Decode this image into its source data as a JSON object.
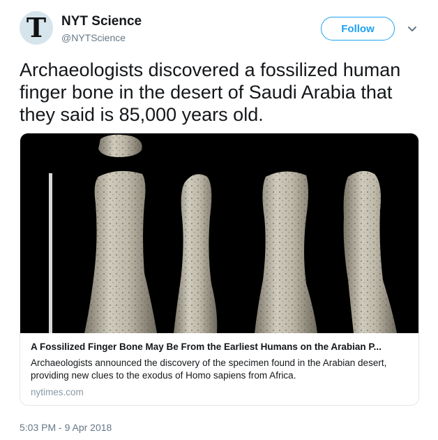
{
  "author": {
    "name": "NYT Science",
    "handle": "@NYTScience",
    "avatar_glyph": "T"
  },
  "follow_label": "Follow",
  "tweet_text": "Archaeologists discovered a fossilized human finger bone in the desert of Saudi Arabia that they said is 85,000 years old.",
  "card": {
    "title": "A Fossilized Finger Bone May Be From the Earliest Humans on the Arabian P...",
    "description": "Archaeologists announced the discovery of the specimen found in the Arabian desert, providing new clues to the exodus of Homo sapiens from Africa.",
    "domain": "nytimes.com"
  },
  "timestamp": "5:03 PM - 9 Apr 2018",
  "colors": {
    "accent": "#1da1f2",
    "muted": "#657786"
  }
}
